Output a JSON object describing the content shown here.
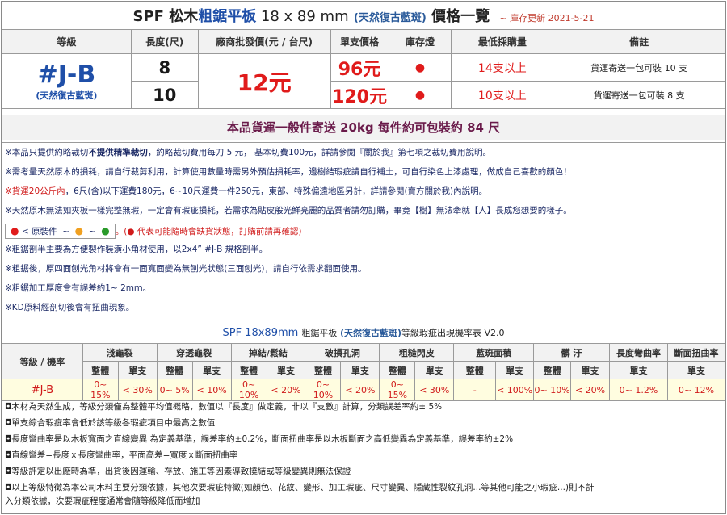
{
  "title": {
    "prefix": "SPF  松木",
    "highlight": "粗鋸平板",
    "size": " 18 x 89 mm",
    "variant": "(天然復古藍斑)",
    "suffix": " 價格一覽",
    "updated": "~ 庫存更新 2021-5-21"
  },
  "price_table": {
    "headers": [
      "等級",
      "長度(尺)",
      "廠商批發價(元 / 台尺)",
      "單支價格",
      "庫存燈",
      "最低採購量",
      "備註"
    ],
    "grade": "#J-B",
    "grade_sub": "(天然復古藍斑)",
    "bulk_price": "12元",
    "rows": [
      {
        "length": "8",
        "unit_price": "96元",
        "stock": "●",
        "min_qty": "14支以上",
        "note": "貨運寄送一包可裝 10 支"
      },
      {
        "length": "10",
        "unit_price": "120元",
        "stock": "●",
        "min_qty": "10支以上",
        "note": "貨運寄送一包可裝 8 支"
      }
    ]
  },
  "shipping_bar": "本品貨運一般件寄送 20kg 每件約可包裝約 84 尺",
  "notes": {
    "n1a": "※本品只提供約略裁切",
    "n1b": "不提供精準裁切",
    "n1c": "，約略裁切費用每刀 5 元， 基本切費100元，詳請參閱『關於我』第七項之裁切費用說明。",
    "n2": "※需考量天然原木的損耗，請自行裁剪利用，計算使用數量時需另外預估損耗率，邊樹結瑕疵請自行補土，可自行染色上漆處理，做成自己喜歡的顏色！",
    "n3a": "※貨運20公斤內",
    "n3b": "，6尺(含)以下運費180元，6~10尺運費一件250元，東部、特殊偏遠地區另計，詳請參閱(賣方關於我)內說明。",
    "n4": "※天然原木無法如夾板一樣完整無瑕，一定會有瑕疵損耗，若需求為貼皮般光鮮亮麗的品質者請勿訂購，畢竟【樹】無法牽就【人】長成您想要的樣子。",
    "n5_legend": "● < 原裝件  ~  ●  ~  ●",
    "n5_tail": "。(● 代表可能隨時會缺貨狀態，訂購前請再確認)",
    "n6": "※粗鋸剖半主要為方便製作裝潢小角材使用，以2x4”  #J-B 規格剖半。",
    "n7": "※粗鋸後，原四面刨光角材將會有一面寬面變為無刨光狀態(三面刨光)，請自行依需求翻面使用。",
    "n8": "※粗鋸加工厚度會有誤差約1~ 2mｍ。",
    "n9": "※KD原料經剖切後會有扭曲現象。"
  },
  "rate_title": {
    "prefix": "SPF 18x89mm ",
    "mid": "粗鋸平板 ",
    "variant": "(天然復古藍斑)",
    "suffix": "等級瑕疵出現機率表  V2.0"
  },
  "rate_table": {
    "grade_header": "等級 / 機率",
    "groups": [
      "淺龜裂",
      "穿透龜裂",
      "掉結/鬆結",
      "破損孔洞",
      "粗糙閃皮",
      "藍斑面積",
      "髒 汙",
      "長度彎曲率",
      "斷面扭曲率"
    ],
    "sub_whole": "整體",
    "sub_single": "單支",
    "grade": "#J-B",
    "values": [
      "0~ 15%",
      "< 30%",
      "0~ 5%",
      "< 10%",
      "0~ 10%",
      "< 20%",
      "0~ 10%",
      "< 20%",
      "0~ 15%",
      "< 30%",
      "-",
      "< 100%",
      "0~ 10%",
      "< 20%",
      "0~ 1.2%",
      "0~ 12%"
    ]
  },
  "footer": [
    "◘木材為天然生成，等級分類僅為整體平均值概略，數值以『長度』做定義，非以『支數』計算，分類誤差率約± 5%",
    "◘單支綜合瑕疵率會低於該等級各瑕疵項目中最高之數值",
    "◘長度彎曲率是以木板寬面之直線變異 為定義基準，誤差率約±0.2%，斷面扭曲率是以木板斷面之高低變異為定義基準，誤差率約±2%",
    "◘直線彎差=長度ｘ長度彎曲率，平面高差=寬度ｘ斷面扭曲率",
    "◘等級評定以出廠時為準，出貨後因運輸、存放、施工等因素導致撓結或等級變異則無法保證",
    "◘以上等級特徵為本公司木料主要分類依據，其他次要瑕疵特徵(如顏色、花紋、變形、加工瑕疵、尺寸變異、隱藏性裂紋孔洞...等其他可能之小瑕疵...)則不計",
    "入分類依據，次要瑕疵程度通常會隨等級降低而增加"
  ],
  "colors": {
    "stock_red": "#e01b1b",
    "stock_orange": "#f0a020",
    "stock_green": "#2a9a2a"
  }
}
